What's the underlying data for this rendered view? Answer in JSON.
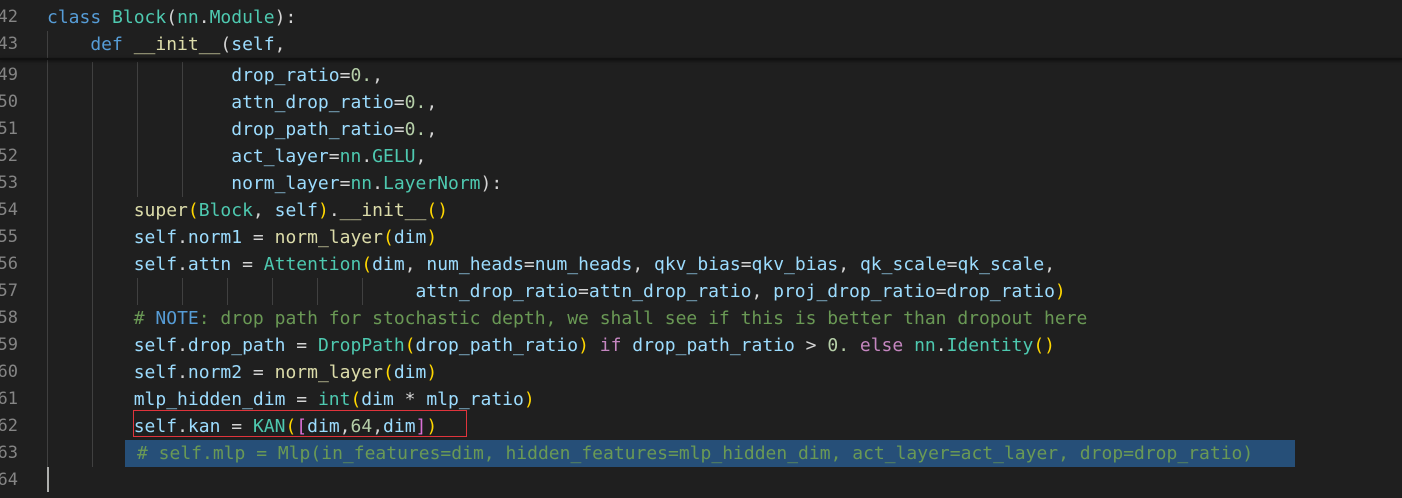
{
  "editor": {
    "lines": [
      {
        "no": "42",
        "tokens": [
          [
            "kw",
            "class "
          ],
          [
            "cls",
            "Block"
          ],
          [
            "op",
            "("
          ],
          [
            "cls",
            "nn"
          ],
          [
            "op",
            "."
          ],
          [
            "cls",
            "Module"
          ],
          [
            "op",
            "):"
          ]
        ]
      },
      {
        "no": "43",
        "tokens": [
          [
            "kw",
            "    def "
          ],
          [
            "fn",
            "__init__"
          ],
          [
            "op",
            "("
          ],
          [
            "self",
            "self"
          ],
          [
            "op",
            ","
          ]
        ]
      },
      {
        "no": "49",
        "tokens": [
          [
            "op",
            "                 "
          ],
          [
            "var",
            "drop_ratio"
          ],
          [
            "op",
            "="
          ],
          [
            "num",
            "0."
          ],
          [
            "op",
            ","
          ]
        ]
      },
      {
        "no": "50",
        "tokens": [
          [
            "op",
            "                 "
          ],
          [
            "var",
            "attn_drop_ratio"
          ],
          [
            "op",
            "="
          ],
          [
            "num",
            "0."
          ],
          [
            "op",
            ","
          ]
        ]
      },
      {
        "no": "51",
        "tokens": [
          [
            "op",
            "                 "
          ],
          [
            "var",
            "drop_path_ratio"
          ],
          [
            "op",
            "="
          ],
          [
            "num",
            "0."
          ],
          [
            "op",
            ","
          ]
        ]
      },
      {
        "no": "52",
        "tokens": [
          [
            "op",
            "                 "
          ],
          [
            "var",
            "act_layer"
          ],
          [
            "op",
            "="
          ],
          [
            "cls",
            "nn"
          ],
          [
            "op",
            "."
          ],
          [
            "cls",
            "GELU"
          ],
          [
            "op",
            ","
          ]
        ]
      },
      {
        "no": "53",
        "tokens": [
          [
            "op",
            "                 "
          ],
          [
            "var",
            "norm_layer"
          ],
          [
            "op",
            "="
          ],
          [
            "cls",
            "nn"
          ],
          [
            "op",
            "."
          ],
          [
            "cls",
            "LayerNorm"
          ],
          [
            "op",
            "):"
          ]
        ]
      },
      {
        "no": "54",
        "tokens": [
          [
            "op",
            "        "
          ],
          [
            "fn",
            "super"
          ],
          [
            "br1",
            "("
          ],
          [
            "cls",
            "Block"
          ],
          [
            "op",
            ", "
          ],
          [
            "self",
            "self"
          ],
          [
            "br1",
            ")"
          ],
          [
            "op",
            "."
          ],
          [
            "fn",
            "__init__"
          ],
          [
            "br1",
            "()"
          ]
        ]
      },
      {
        "no": "55",
        "tokens": [
          [
            "op",
            "        "
          ],
          [
            "self",
            "self"
          ],
          [
            "op",
            "."
          ],
          [
            "var",
            "norm1"
          ],
          [
            "op",
            " = "
          ],
          [
            "fn",
            "norm_layer"
          ],
          [
            "br1",
            "("
          ],
          [
            "var",
            "dim"
          ],
          [
            "br1",
            ")"
          ]
        ]
      },
      {
        "no": "56",
        "tokens": [
          [
            "op",
            "        "
          ],
          [
            "self",
            "self"
          ],
          [
            "op",
            "."
          ],
          [
            "var",
            "attn"
          ],
          [
            "op",
            " = "
          ],
          [
            "cls",
            "Attention"
          ],
          [
            "br1",
            "("
          ],
          [
            "var",
            "dim"
          ],
          [
            "op",
            ", "
          ],
          [
            "var",
            "num_heads"
          ],
          [
            "op",
            "="
          ],
          [
            "var",
            "num_heads"
          ],
          [
            "op",
            ", "
          ],
          [
            "var",
            "qkv_bias"
          ],
          [
            "op",
            "="
          ],
          [
            "var",
            "qkv_bias"
          ],
          [
            "op",
            ", "
          ],
          [
            "var",
            "qk_scale"
          ],
          [
            "op",
            "="
          ],
          [
            "var",
            "qk_scale"
          ],
          [
            "op",
            ","
          ]
        ]
      },
      {
        "no": "57",
        "tokens": [
          [
            "op",
            "                                  "
          ],
          [
            "var",
            "attn_drop_ratio"
          ],
          [
            "op",
            "="
          ],
          [
            "var",
            "attn_drop_ratio"
          ],
          [
            "op",
            ", "
          ],
          [
            "var",
            "proj_drop_ratio"
          ],
          [
            "op",
            "="
          ],
          [
            "var",
            "drop_ratio"
          ],
          [
            "br1",
            ")"
          ]
        ]
      },
      {
        "no": "58",
        "tokens": [
          [
            "op",
            "        "
          ],
          [
            "cm",
            "# "
          ],
          [
            "kw",
            "NOTE"
          ],
          [
            "cm",
            ": drop path for stochastic depth, we shall see if this is better than dropout here"
          ]
        ]
      },
      {
        "no": "59",
        "tokens": [
          [
            "op",
            "        "
          ],
          [
            "self",
            "self"
          ],
          [
            "op",
            "."
          ],
          [
            "var",
            "drop_path"
          ],
          [
            "op",
            " = "
          ],
          [
            "cls",
            "DropPath"
          ],
          [
            "br1",
            "("
          ],
          [
            "var",
            "drop_path_ratio"
          ],
          [
            "br1",
            ")"
          ],
          [
            "kw2",
            " if "
          ],
          [
            "var",
            "drop_path_ratio"
          ],
          [
            "op",
            " > "
          ],
          [
            "num",
            "0."
          ],
          [
            "kw2",
            " else "
          ],
          [
            "cls",
            "nn"
          ],
          [
            "op",
            "."
          ],
          [
            "cls",
            "Identity"
          ],
          [
            "br1",
            "()"
          ]
        ]
      },
      {
        "no": "60",
        "tokens": [
          [
            "op",
            "        "
          ],
          [
            "self",
            "self"
          ],
          [
            "op",
            "."
          ],
          [
            "var",
            "norm2"
          ],
          [
            "op",
            " = "
          ],
          [
            "fn",
            "norm_layer"
          ],
          [
            "br1",
            "("
          ],
          [
            "var",
            "dim"
          ],
          [
            "br1",
            ")"
          ]
        ]
      },
      {
        "no": "61",
        "tokens": [
          [
            "op",
            "        "
          ],
          [
            "var",
            "mlp_hidden_dim"
          ],
          [
            "op",
            " = "
          ],
          [
            "cls",
            "int"
          ],
          [
            "br1",
            "("
          ],
          [
            "var",
            "dim"
          ],
          [
            "op",
            " * "
          ],
          [
            "var",
            "mlp_ratio"
          ],
          [
            "br1",
            ")"
          ]
        ]
      },
      {
        "no": "62",
        "tokens": [
          [
            "op",
            "        "
          ],
          [
            "self",
            "self"
          ],
          [
            "op",
            "."
          ],
          [
            "var",
            "kan"
          ],
          [
            "op",
            " = "
          ],
          [
            "cls",
            "KAN"
          ],
          [
            "br1",
            "("
          ],
          [
            "br2",
            "["
          ],
          [
            "var",
            "dim"
          ],
          [
            "op",
            ","
          ],
          [
            "num",
            "64"
          ],
          [
            "op",
            ","
          ],
          [
            "var",
            "dim"
          ],
          [
            "br2",
            "]"
          ],
          [
            "br1",
            ")"
          ]
        ]
      },
      {
        "no": "63",
        "tokens": []
      },
      {
        "no": "64",
        "tokens": []
      }
    ],
    "selected_comment": "# self.mlp = Mlp(in_features=dim, hidden_features=mlp_hidden_dim, act_layer=act_layer, drop=drop_ratio)"
  },
  "colors": {
    "background": "#1f1f1f",
    "selection": "#264f78",
    "highlight_box": "#e0343c"
  }
}
